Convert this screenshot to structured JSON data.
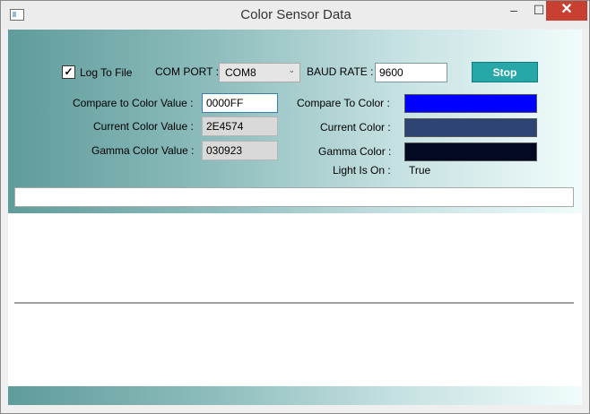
{
  "window": {
    "title": "Color Sensor Data",
    "min_glyph": "–",
    "max_glyph": "☐",
    "close_glyph": "✕"
  },
  "top": {
    "log_to_file_label": "Log To File",
    "log_to_file_checked": true,
    "com_port_label": "COM PORT :",
    "com_port_value": "COM8",
    "baud_rate_label": "BAUD RATE :",
    "baud_rate_value": "9600",
    "stop_label": "Stop"
  },
  "values": {
    "compare_label": "Compare to Color Value :",
    "compare_value": "0000FF",
    "current_label": "Current Color Value :",
    "current_value": "2E4574",
    "gamma_label": "Gamma Color Value :",
    "gamma_value": "030923"
  },
  "colors": {
    "compare_label": "Compare To Color :",
    "compare_hex": "#0000FF",
    "current_label": "Current Color :",
    "current_hex": "#2E4574",
    "gamma_label": "Gamma Color :",
    "gamma_hex": "#030923",
    "light_label": "Light Is On :",
    "light_value": "True"
  },
  "icons": {
    "check": "check-icon",
    "dropdown": "chevron-down-icon"
  }
}
